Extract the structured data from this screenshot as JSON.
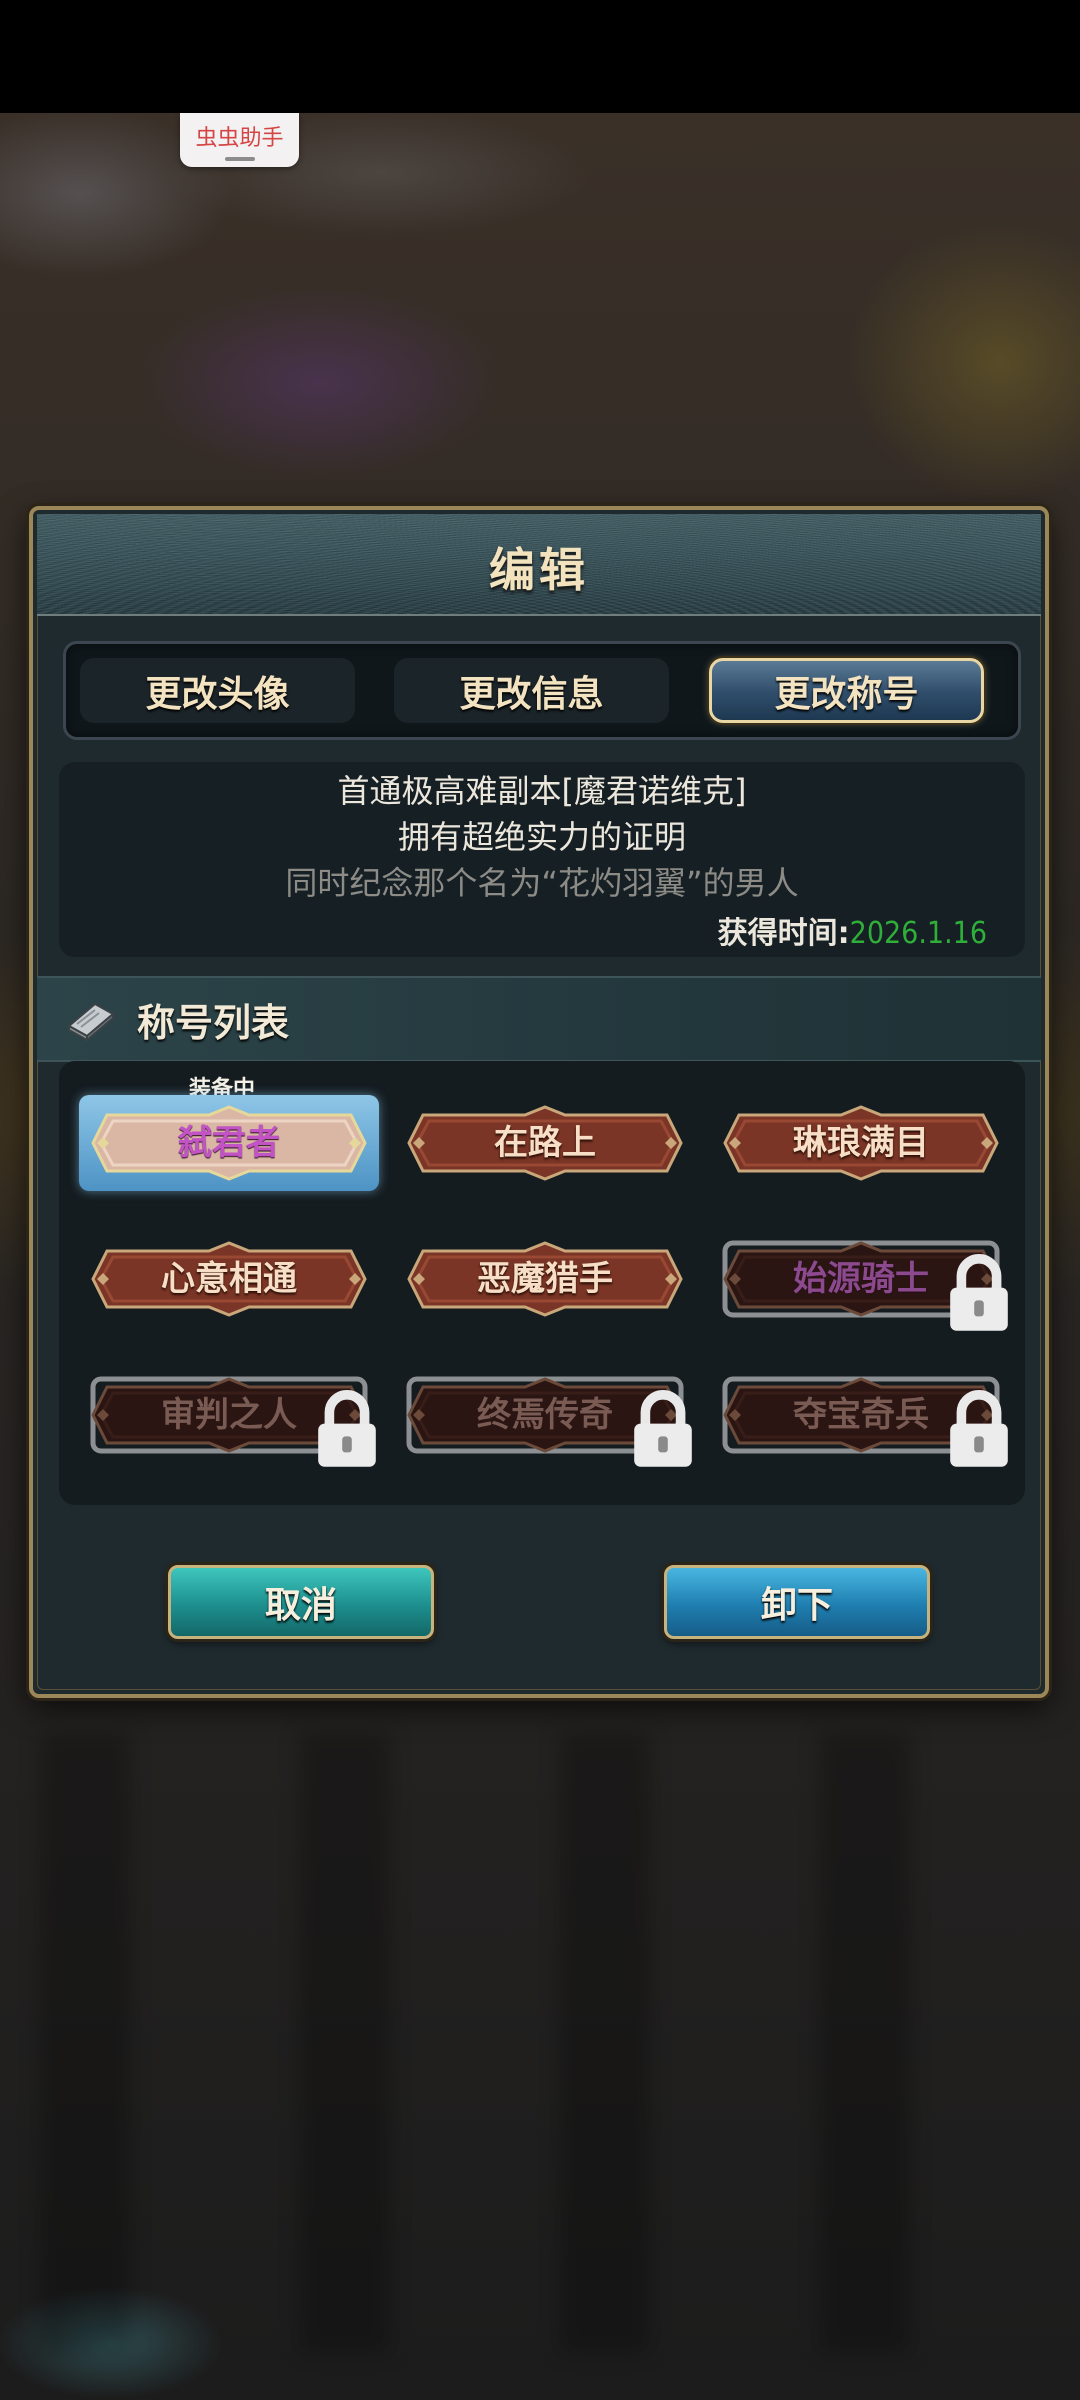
{
  "overlay": {
    "floating_tag": "虫虫助手"
  },
  "dialog": {
    "title": "编辑",
    "tabs": [
      {
        "label": "更改头像",
        "active": false
      },
      {
        "label": "更改信息",
        "active": false
      },
      {
        "label": "更改称号",
        "active": true
      }
    ],
    "description": {
      "lines": [
        "首通极高难副本[魔君诺维克]",
        "拥有超绝实力的证明",
        "同时纪念那个名为“花灼羽翼”的男人"
      ],
      "obtain_label": "获得时间:",
      "obtain_date": "2026.1.16"
    },
    "section_title": "称号列表",
    "equipped_label": "装备中",
    "titles": [
      {
        "name": "弑君者",
        "locked": false,
        "equipped": true,
        "color": "purple"
      },
      {
        "name": "在路上",
        "locked": false,
        "equipped": false
      },
      {
        "name": "琳琅满目",
        "locked": false,
        "equipped": false
      },
      {
        "name": "心意相通",
        "locked": false,
        "equipped": false
      },
      {
        "name": "恶魔猎手",
        "locked": false,
        "equipped": false
      },
      {
        "name": "始源骑士",
        "locked": true,
        "equipped": false,
        "color": "purple"
      },
      {
        "name": "审判之人",
        "locked": true,
        "equipped": false
      },
      {
        "name": "终焉传奇",
        "locked": true,
        "equipped": false
      },
      {
        "name": "夺宝奇兵",
        "locked": true,
        "equipped": false
      }
    ],
    "buttons": {
      "cancel": "取消",
      "remove": "卸下"
    }
  },
  "colors": {
    "accent_gold": "#9c8758",
    "obtain_date": "#2fae3a",
    "purple_title": "#c253c5"
  }
}
